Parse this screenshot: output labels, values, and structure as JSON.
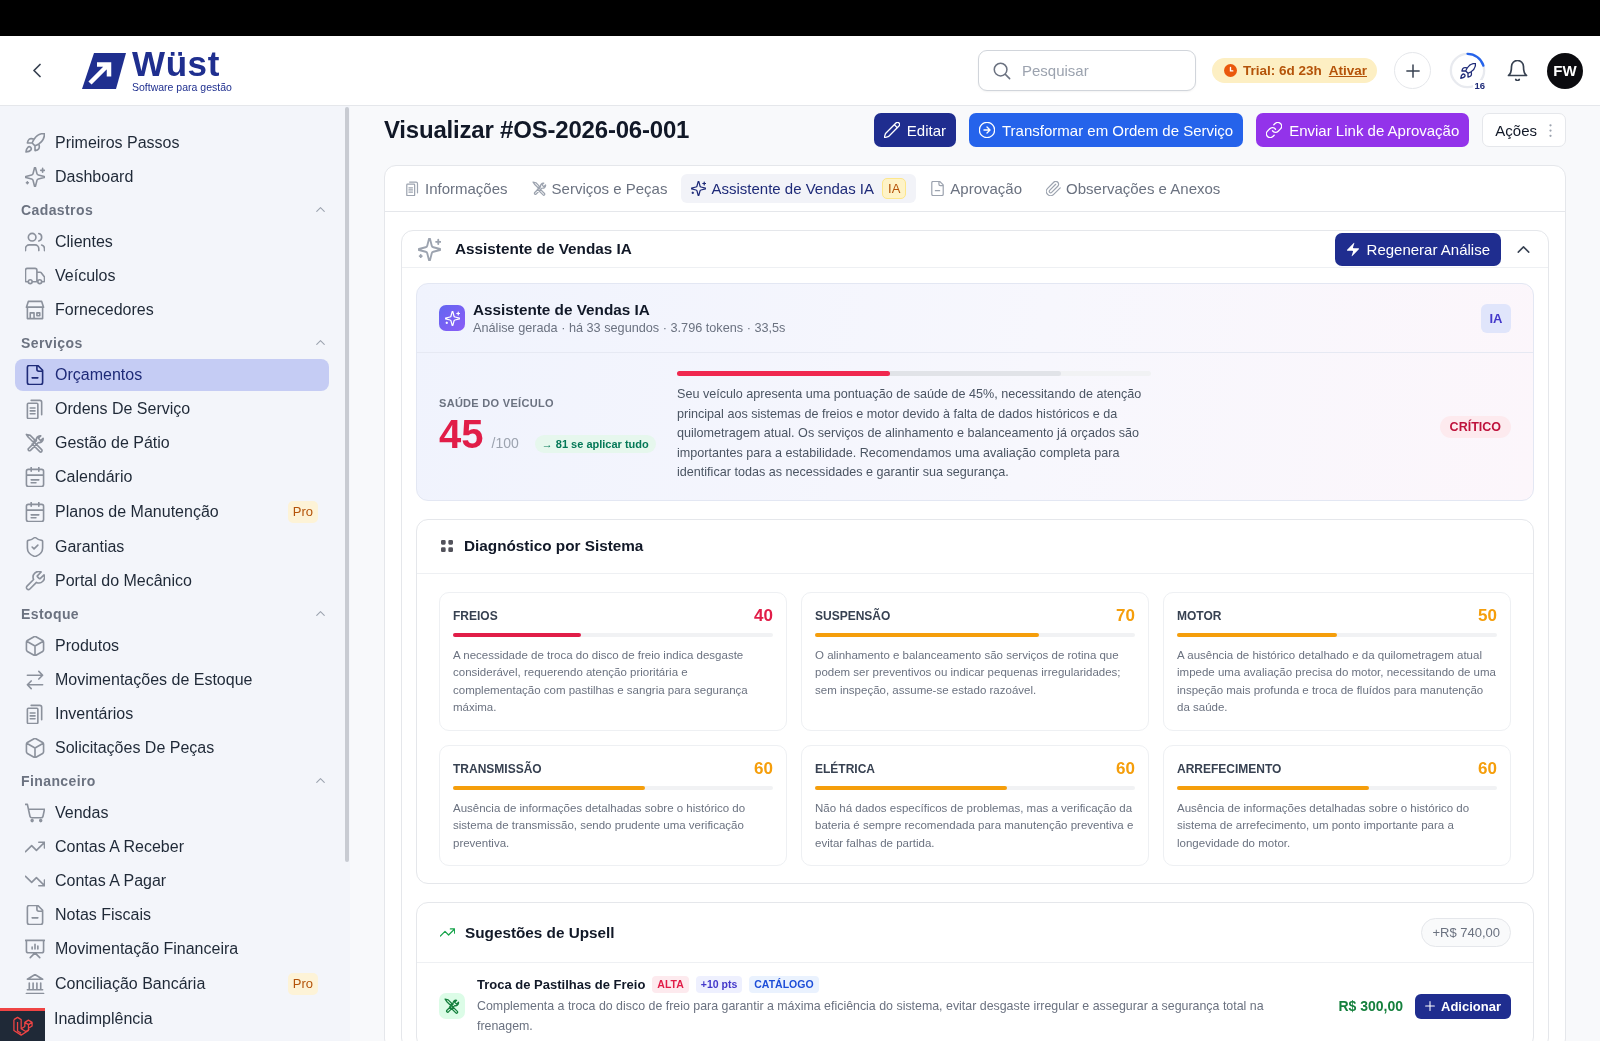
{
  "header": {
    "logo": {
      "name": "Wüst",
      "tagline": "Software para gestão"
    },
    "search": {
      "placeholder": "Pesquisar"
    },
    "trial": {
      "label": "Trial: 6d 23h",
      "link": "Ativar"
    },
    "onboarding": {
      "count": "16",
      "level": 0.2
    },
    "user": {
      "initials": "FW"
    }
  },
  "sidebar": {
    "items": [
      {
        "label": "Primeiros Passos",
        "selected": false
      },
      {
        "label": "Dashboard",
        "selected": false
      }
    ],
    "sections": [
      {
        "title": "Cadastros",
        "expanded": true,
        "items": [
          {
            "label": "Clientes",
            "selected": false
          },
          {
            "label": "Veículos",
            "selected": false
          },
          {
            "label": "Fornecedores",
            "selected": false
          }
        ]
      },
      {
        "title": "Serviços",
        "expanded": true,
        "items": [
          {
            "label": "Orçamentos",
            "selected": true
          },
          {
            "label": "Ordens De Serviço",
            "selected": false
          },
          {
            "label": "Gestão de Pátio",
            "selected": false
          },
          {
            "label": "Calendário",
            "selected": false
          },
          {
            "label": "Planos de Manutenção",
            "selected": false,
            "badge": "Pro"
          },
          {
            "label": "Garantias",
            "selected": false
          },
          {
            "label": "Portal do Mecânico",
            "selected": false
          }
        ]
      },
      {
        "title": "Estoque",
        "expanded": true,
        "items": [
          {
            "label": "Produtos",
            "selected": false
          },
          {
            "label": "Movimentações de Estoque",
            "selected": false
          },
          {
            "label": "Inventários",
            "selected": false
          },
          {
            "label": "Solicitações De Peças",
            "selected": false
          }
        ]
      },
      {
        "title": "Financeiro",
        "expanded": true,
        "items": [
          {
            "label": "Vendas",
            "selected": false
          },
          {
            "label": "Contas A Receber",
            "selected": false
          },
          {
            "label": "Contas A Pagar",
            "selected": false
          },
          {
            "label": "Notas Fiscais",
            "selected": false
          },
          {
            "label": "Movimentação Financeira",
            "selected": false
          },
          {
            "label": "Conciliação Bancária",
            "selected": false,
            "badge": "Pro"
          },
          {
            "label": "Inadimplência",
            "selected": false
          }
        ]
      }
    ]
  },
  "page": {
    "title": "Visualizar #OS-2026-06-001",
    "actions": [
      {
        "label": "Editar",
        "kind": "primary"
      },
      {
        "label": "Transformar em Ordem de Serviço",
        "kind": "info"
      },
      {
        "label": "Enviar Link de Aprovação",
        "kind": "accent"
      },
      {
        "label": "Ações",
        "kind": "menu"
      }
    ]
  },
  "tabs": [
    {
      "label": "Informações",
      "selected": false
    },
    {
      "label": "Serviços e Peças",
      "selected": false
    },
    {
      "label": "Assistente de Vendas IA",
      "selected": true,
      "badge": "IA"
    },
    {
      "label": "Aprovação",
      "selected": false
    },
    {
      "label": "Observações e Anexos",
      "selected": false
    }
  ],
  "assistant": {
    "title": "Assistente de Vendas IA",
    "button": "Regenerar Análise",
    "expanded": true,
    "summary": {
      "title": "Assistente de Vendas IA",
      "meta": "Análise gerada · há 33 segundos · 3.796 tokens · 33,5s",
      "badge": "IA",
      "health_label": "SAÚDE DO VEÍCULO",
      "score": "45",
      "score_max": "/100",
      "potential": "→ 81 se aplicar tudo",
      "health_bar": {
        "level": 0.45,
        "potential": {
          "level": 0.81
        }
      },
      "text": "Seu veículo apresenta uma pontuação de saúde de 45%, necessitando de atenção principal aos sistemas de freios e motor devido à falta de dados históricos e da quilometragem atual. Os serviços de alinhamento e balanceamento já orçados são importantes para a estabilidade. Recomendamos uma avaliação completa para identificar todas as necessidades e garantir sua segurança.",
      "status": "CRÍTICO"
    },
    "diagnostics": {
      "title": "Diagnóstico por Sistema",
      "systems": [
        {
          "name": "FREIOS",
          "score": "40",
          "level": 0.4,
          "color": "#e11d48",
          "description": "A necessidade de troca do disco de freio indica desgaste considerável, requerendo atenção prioritária e complementação com pastilhas e sangria para segurança máxima."
        },
        {
          "name": "SUSPENSÃO",
          "score": "70",
          "level": 0.7,
          "color": "#f59e0b",
          "description": "O alinhamento e balanceamento são serviços de rotina que podem ser preventivos ou indicar pequenas irregularidades; sem inspeção, assume-se estado razoável."
        },
        {
          "name": "MOTOR",
          "score": "50",
          "level": 0.5,
          "color": "#f59e0b",
          "description": "A ausência de histórico detalhado e da quilometragem atual impede uma avaliação precisa do motor, necessitando de uma inspeção mais profunda e troca de fluídos para manutenção da saúde."
        },
        {
          "name": "TRANSMISSÃO",
          "score": "60",
          "level": 0.6,
          "color": "#f59e0b",
          "description": "Ausência de informações detalhadas sobre o histórico do sistema de transmissão, sendo prudente uma verificação preventiva."
        },
        {
          "name": "ELÉTRICA",
          "score": "60",
          "level": 0.6,
          "color": "#f59e0b",
          "description": "Não há dados específicos de problemas, mas a verificação da bateria é sempre recomendada para manutenção preventiva e evitar falhas de partida."
        },
        {
          "name": "ARREFECIMENTO",
          "score": "60",
          "level": 0.6,
          "color": "#f59e0b",
          "description": "Ausência de informações detalhadas sobre o histórico do sistema de arrefecimento, um ponto importante para a longevidade do motor."
        }
      ]
    },
    "upsell": {
      "title": "Sugestões de Upsell",
      "total": "+R$ 740,00",
      "items": [
        {
          "title": "Troca de Pastilhas de Freio",
          "tags": [
            {
              "label": "ALTA",
              "kind": "priority"
            },
            {
              "label": "+10 pts",
              "kind": "points"
            },
            {
              "label": "CATÁLOGO",
              "kind": "source"
            }
          ],
          "description": "Complementa a troca do disco de freio para garantir a máxima eficiência do sistema, evitar desgaste irregular e assegurar a segurança total na frenagem.",
          "price": "R$ 300,00",
          "button": "Adicionar"
        }
      ]
    }
  }
}
